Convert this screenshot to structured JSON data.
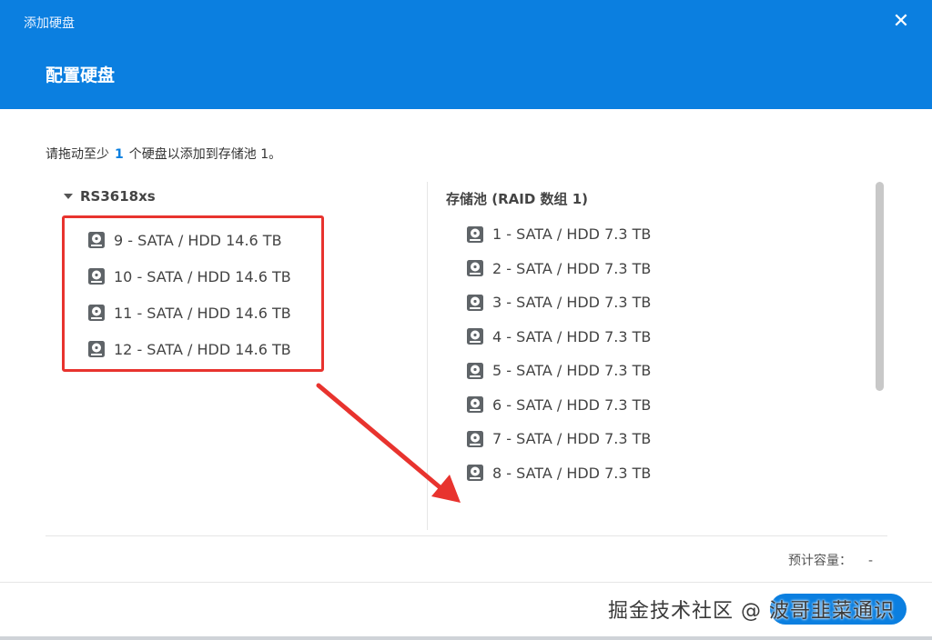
{
  "window": {
    "title": "添加硬盘",
    "close_icon": "✕"
  },
  "wizard": {
    "step_title": "配置硬盘",
    "instruction_prefix": "请拖动至少",
    "instruction_count": "1",
    "instruction_suffix": "个硬盘以添加到存储池 1。"
  },
  "source": {
    "device_name": "RS3618xs",
    "disks": [
      "9 - SATA / HDD 14.6 TB",
      "10 - SATA / HDD 14.6 TB",
      "11 - SATA / HDD 14.6 TB",
      "12 - SATA / HDD 14.6 TB"
    ]
  },
  "target": {
    "pool_name": "存储池 (RAID 数组 1)",
    "disks": [
      "1 - SATA / HDD 7.3 TB",
      "2 - SATA / HDD 7.3 TB",
      "3 - SATA / HDD 7.3 TB",
      "4 - SATA / HDD 7.3 TB",
      "5 - SATA / HDD 7.3 TB",
      "6 - SATA / HDD 7.3 TB",
      "7 - SATA / HDD 7.3 TB",
      "8 - SATA / HDD 7.3 TB"
    ]
  },
  "summary": {
    "capacity_label": "预计容量：",
    "capacity_value": "-"
  },
  "watermark": {
    "text": "掘金技术社区 @ 波哥韭菜通识"
  },
  "colors": {
    "header_blue": "#0b7fe0",
    "annotation_red": "#e8332e"
  },
  "icons": {
    "disk": "hard-disk-icon",
    "caret": "caret-down-icon",
    "close": "close-icon"
  }
}
